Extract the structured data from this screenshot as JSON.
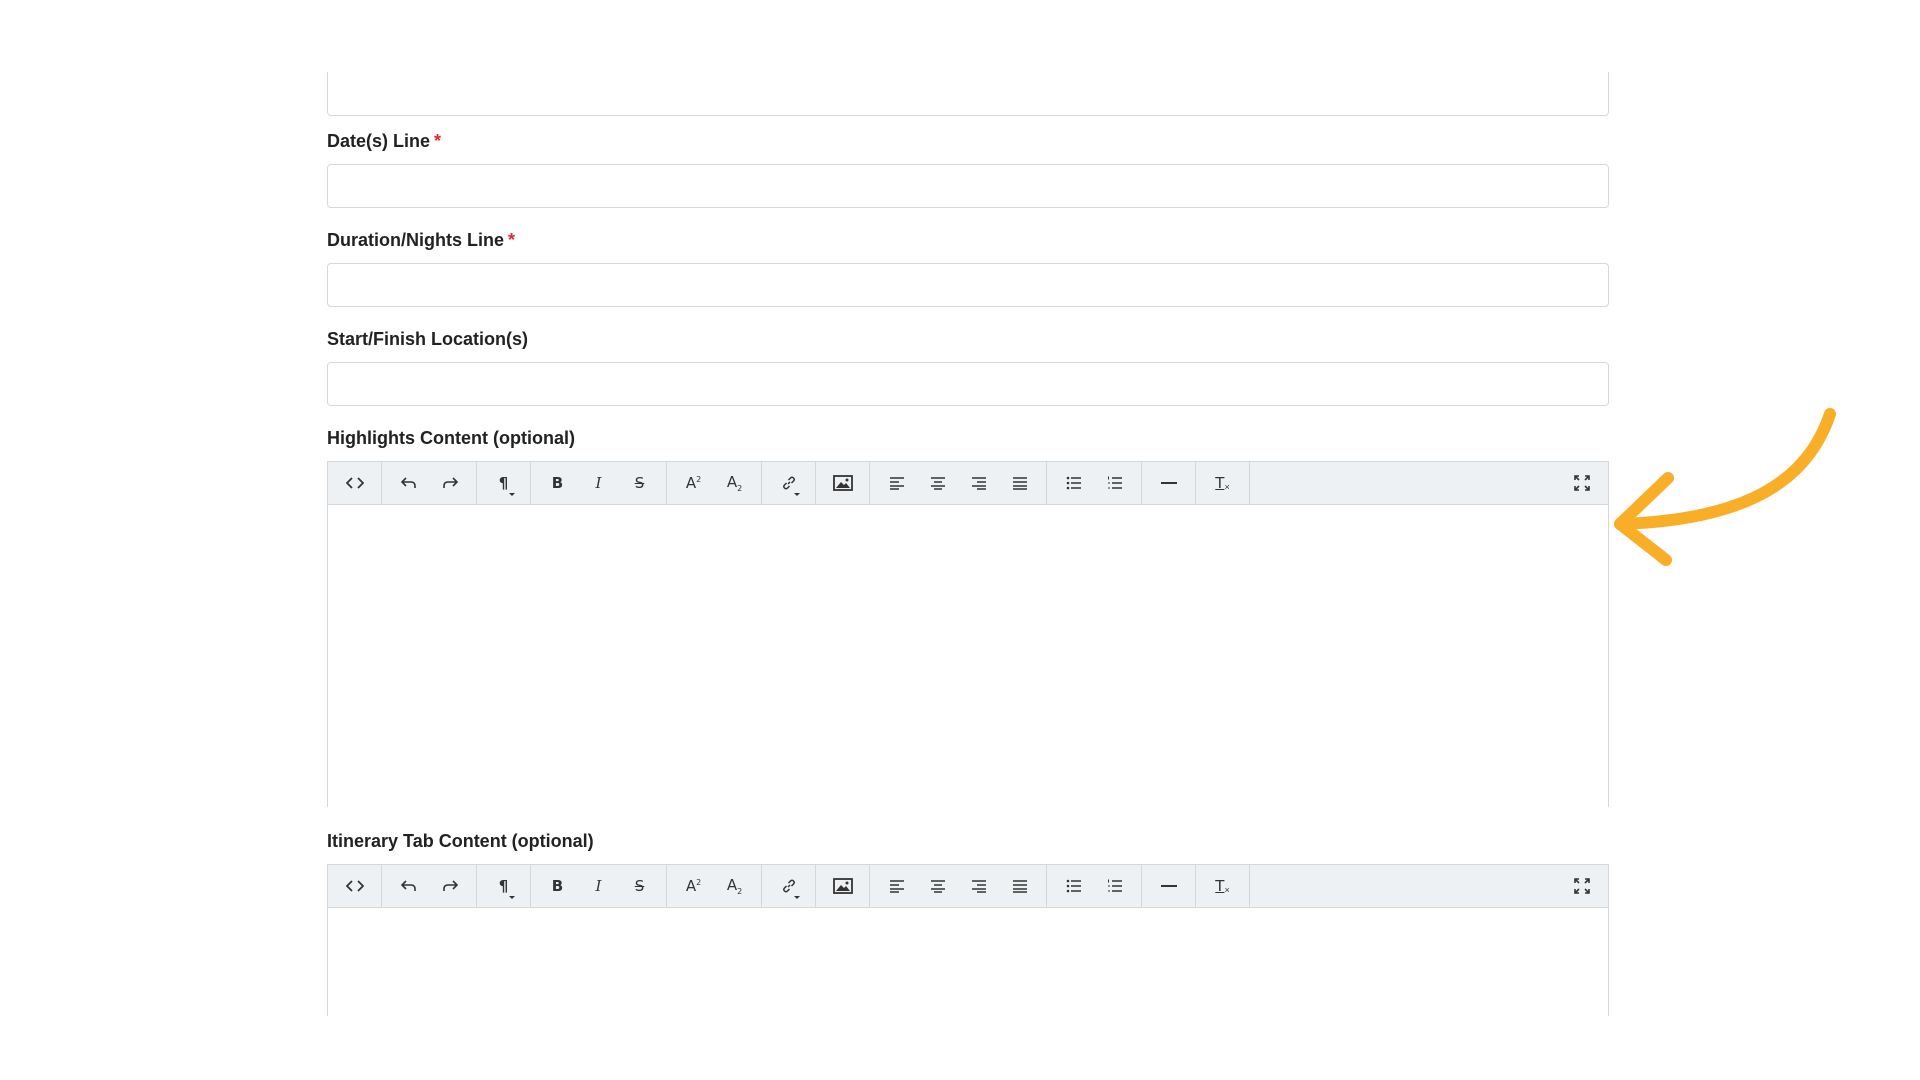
{
  "form": {
    "fields": [
      {
        "label": "Date(s) Line",
        "required_mark": "*",
        "value": ""
      },
      {
        "label": "Duration/Nights Line",
        "required_mark": "*",
        "value": ""
      },
      {
        "label": "Start/Finish Location(s)",
        "value": ""
      }
    ],
    "editors": [
      {
        "label": "Highlights Content (optional)",
        "content": ""
      },
      {
        "label": "Itinerary Tab Content (optional)",
        "content": ""
      }
    ]
  },
  "toolbar_icons": [
    "code-view-icon",
    "undo-icon",
    "redo-icon",
    "paragraph-icon",
    "bold-icon",
    "italic-icon",
    "strikethrough-icon",
    "superscript-icon",
    "subscript-icon",
    "link-icon",
    "image-icon",
    "align-left-icon",
    "align-center-icon",
    "align-right-icon",
    "align-justify-icon",
    "bulleted-list-icon",
    "numbered-list-icon",
    "horizontal-rule-icon",
    "clear-formatting-icon",
    "fullscreen-icon"
  ],
  "colors": {
    "required": "#e0282e",
    "toolbar_bg": "#eef1f3",
    "border": "#d4d7db",
    "annotation_arrow": "#f8ae26"
  }
}
